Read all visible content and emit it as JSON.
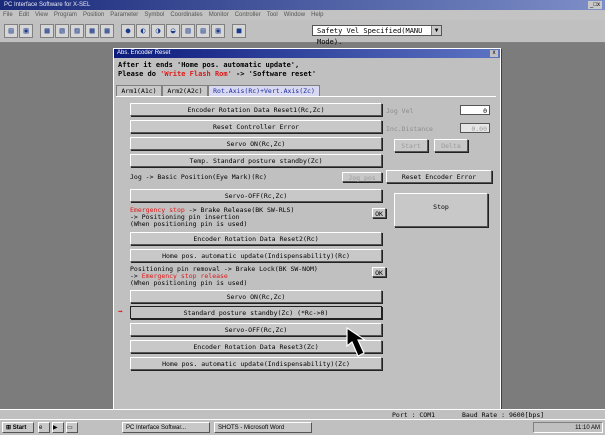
{
  "window": {
    "title": "PC Interface Software for X-SEL"
  },
  "menu": [
    "File",
    "Edit",
    "View",
    "Program",
    "Position",
    "Parameter",
    "Symbol",
    "Coordinates",
    "Monitor",
    "Controller",
    "Tool",
    "Window",
    "Help"
  ],
  "toolbar": {
    "mode_select": "Safety Vel Specified(MANU Mode)."
  },
  "dialog": {
    "title": "Abs. Encoder Reset",
    "instr1": "After it ends 'Home pos. automatic update',",
    "instr2_pre": "Please do ",
    "instr2_red": "'Write Flash Rom'",
    "instr2_post": " -> 'Software reset'",
    "tabs": [
      "Arm1(A1c)",
      "Arm2(A2c)",
      "Rot.Axis(Rc)+Vert.Axis(Zc)"
    ],
    "buttons": {
      "b1": "Encoder Rotation Data Reset1(Rc,Zc)",
      "b2": "Reset Controller Error",
      "b3": "Servo ON(Rc,Zc)",
      "b4": "Temp. Standard posture standby(Zc)",
      "b5": "Servo-OFF(Rc,Zc)",
      "b6": "Encoder Rotation Data Reset2(Rc)",
      "b7": "Home pos. automatic update(Indispensability)(Rc)",
      "b8": "Servo ON(Rc,Zc)",
      "b9": "Standard posture standby(Zc) (*Rc->0)",
      "b10": "Servo-OFF(Rc,Zc)",
      "b11": "Encoder Rotation Data Reset3(Zc)",
      "b12": "Home pos. automatic update(Indispensability)(Zc)",
      "jog_btn": "Jog pos",
      "ok1": "OK",
      "ok2": "OK",
      "reset_enc": "Reset Encoder Error",
      "stop": "Stop",
      "start": "Start",
      "delta": "Delta"
    },
    "jog_label": "Jog -> Basic Position(Eye Mark)(Rc)",
    "emerg1_red": "Emergency stop",
    "emerg1_rest": " -> Brake Release(BK SW-RLS)",
    "emerg1_l2": " -> Positioning pin insertion",
    "emerg1_l3": "(When positioning pin is used)",
    "posrem_l1": "Positioning pin removal -> Brake Lock(BK SW-NOM)",
    "posrem_l2_pre": " -> ",
    "posrem_l2_red": "Emergency stop release",
    "posrem_l3": "(When positioning pin is used)",
    "jog_vel_label": "Jog Vel",
    "jog_vel_value": "0",
    "inc_label": "Inc.Distance",
    "inc_value": "0.00"
  },
  "statusbar": {
    "port": "Port : COM1",
    "baud": "Baud Rate : 9600[bps]"
  },
  "taskbar": {
    "start": "Start",
    "task1": "PC Interface Softwar...",
    "task2": "SHOTS - Microsoft Word",
    "clock": "11:10 AM"
  }
}
